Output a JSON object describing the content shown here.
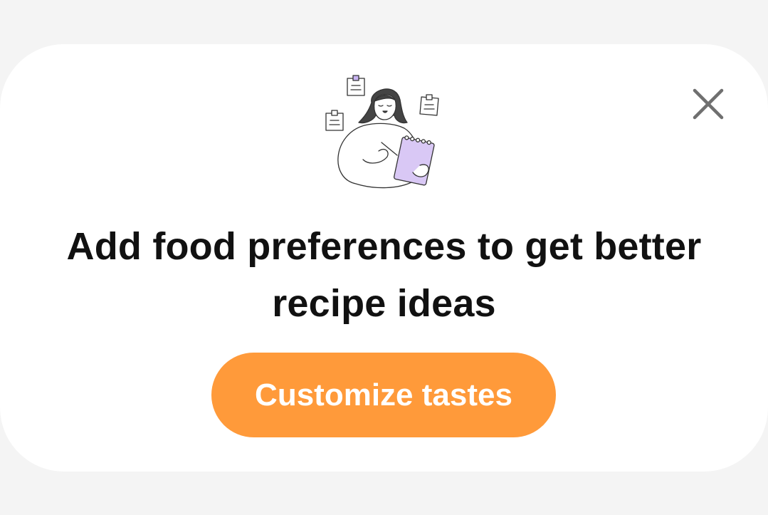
{
  "dialog": {
    "headline": "Add food preferences to get better recipe ideas",
    "cta_label": "Customize tastes",
    "close_icon": "close-icon",
    "illustration_icon": "woman-writing-notes-illustration"
  },
  "colors": {
    "background": "#f4f4f4",
    "card": "#ffffff",
    "accent": "#ff9a3a",
    "notepad": "#d9c8f5",
    "close_icon": "#6f6f6f"
  }
}
